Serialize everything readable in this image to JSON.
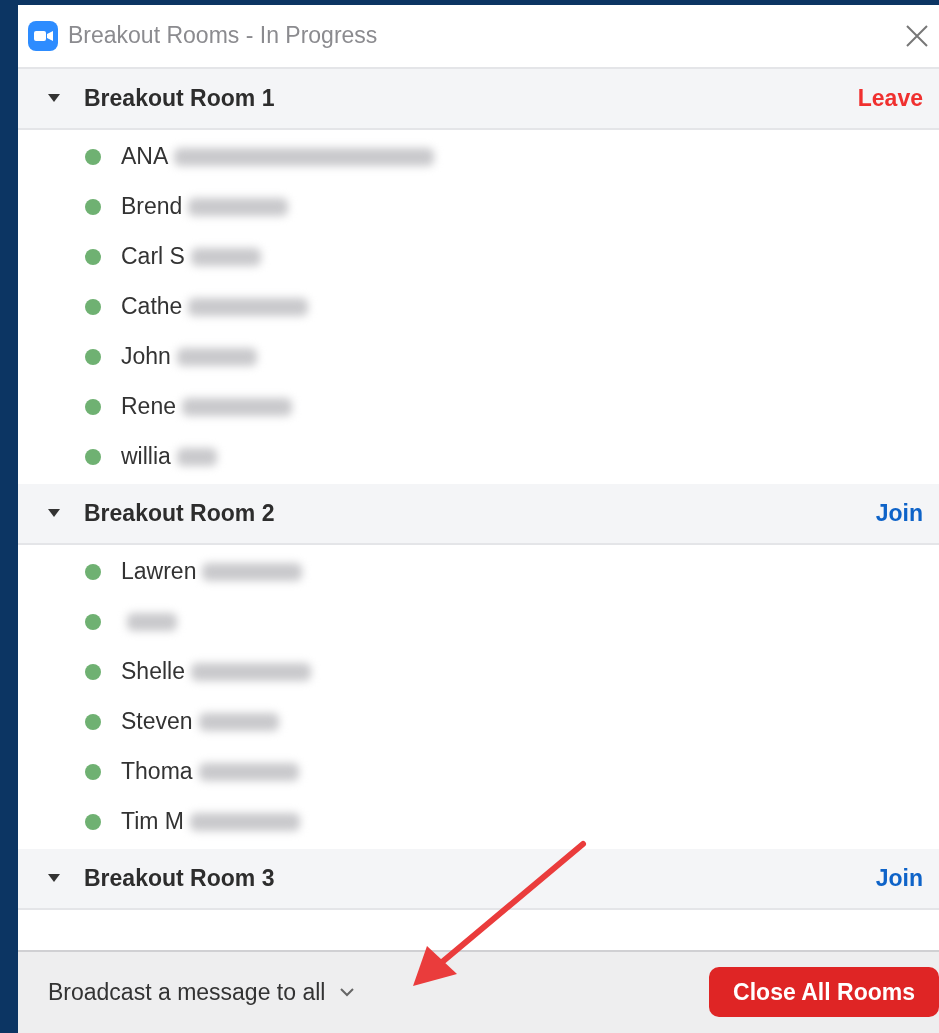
{
  "window": {
    "title": "Breakout Rooms - In Progress"
  },
  "rooms": [
    {
      "name": "Breakout Room 1",
      "expanded": true,
      "action": {
        "label": "Leave",
        "kind": "leave"
      },
      "members": [
        {
          "name": "ANA",
          "color": "#6fb172"
        },
        {
          "name": "Brend",
          "color": "#6fb172"
        },
        {
          "name": "Carl S",
          "color": "#6fb172"
        },
        {
          "name": "Cathe",
          "color": "#6fb172"
        },
        {
          "name": "John",
          "color": "#6fb172"
        },
        {
          "name": "Rene",
          "color": "#6fb172"
        },
        {
          "name": "willia",
          "color": "#6fb172"
        }
      ]
    },
    {
      "name": "Breakout Room 2",
      "expanded": true,
      "action": {
        "label": "Join",
        "kind": "join"
      },
      "members": [
        {
          "name": "Lawren",
          "color": "#6fb172"
        },
        {
          "color": "#6fb172"
        },
        {
          "name": "Shelle",
          "color": "#6fb172"
        },
        {
          "name": "Steven",
          "color": "#6fb172"
        },
        {
          "name": "Thoma",
          "color": "#6fb172"
        },
        {
          "name": "Tim M",
          "color": "#6fb172"
        }
      ]
    },
    {
      "name": "Breakout Room 3",
      "expanded": true,
      "action": {
        "label": "Join",
        "kind": "join"
      }
    }
  ],
  "footer": {
    "broadcast": "Broadcast a message to all",
    "close_button": "Close All Rooms"
  }
}
